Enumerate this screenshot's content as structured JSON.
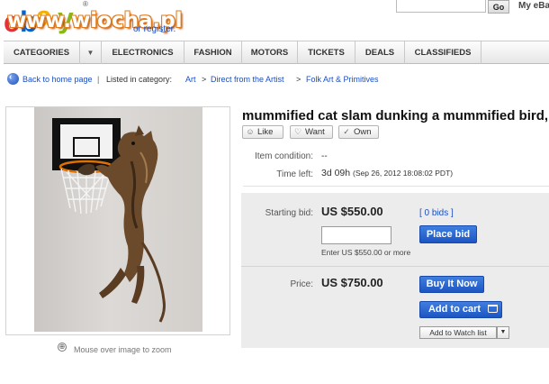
{
  "header": {
    "logo_letters": [
      "e",
      "b",
      "a",
      "y"
    ],
    "logo_registered": "®",
    "watermark": "www.wiocha.pl",
    "register_text": "or register.",
    "search_go": "Go",
    "my_ebay": "My eBa"
  },
  "nav": {
    "items": [
      "CATEGORIES",
      "ELECTRONICS",
      "FASHION",
      "MOTORS",
      "TICKETS",
      "DEALS",
      "CLASSIFIEDS"
    ],
    "arrow": "▼"
  },
  "breadcrumb": {
    "back": "Back to home page",
    "separator": "|",
    "listed": "Listed in category:",
    "path": [
      "Art",
      "Direct from the Artist",
      "Folk Art & Primitives"
    ],
    "gt": ">"
  },
  "image": {
    "zoom_icon": "⊕",
    "zoom_text": "Mouse over image to zoom"
  },
  "item": {
    "title": "mummified cat slam dunking a mummified bird, c",
    "social": {
      "like": "Like",
      "want": "Want",
      "own": "Own"
    },
    "condition_label": "Item condition:",
    "condition_value": "--",
    "time_label": "Time left:",
    "time_value": "3d 09h",
    "time_date": "(Sep 26, 2012  18:08:02 PDT)"
  },
  "bid": {
    "label": "Starting bid:",
    "value": "US $550.00",
    "bids_link": "[ 0 bids ]",
    "input_value": "",
    "enter_text": "Enter US $550.00 or more",
    "place_bid": "Place bid"
  },
  "buy": {
    "label": "Price:",
    "value": "US $750.00",
    "buy_now": "Buy It Now",
    "add_to_cart": "Add to cart",
    "add_to_watch": "Add to Watch list",
    "dropdown": "▼"
  },
  "colors": {
    "link": "#1a4ec2",
    "button_blue": "#1d55c3",
    "logo_red": "#e53238",
    "logo_blue": "#0064d2",
    "logo_yellow": "#f5af02",
    "logo_green": "#86b817"
  }
}
